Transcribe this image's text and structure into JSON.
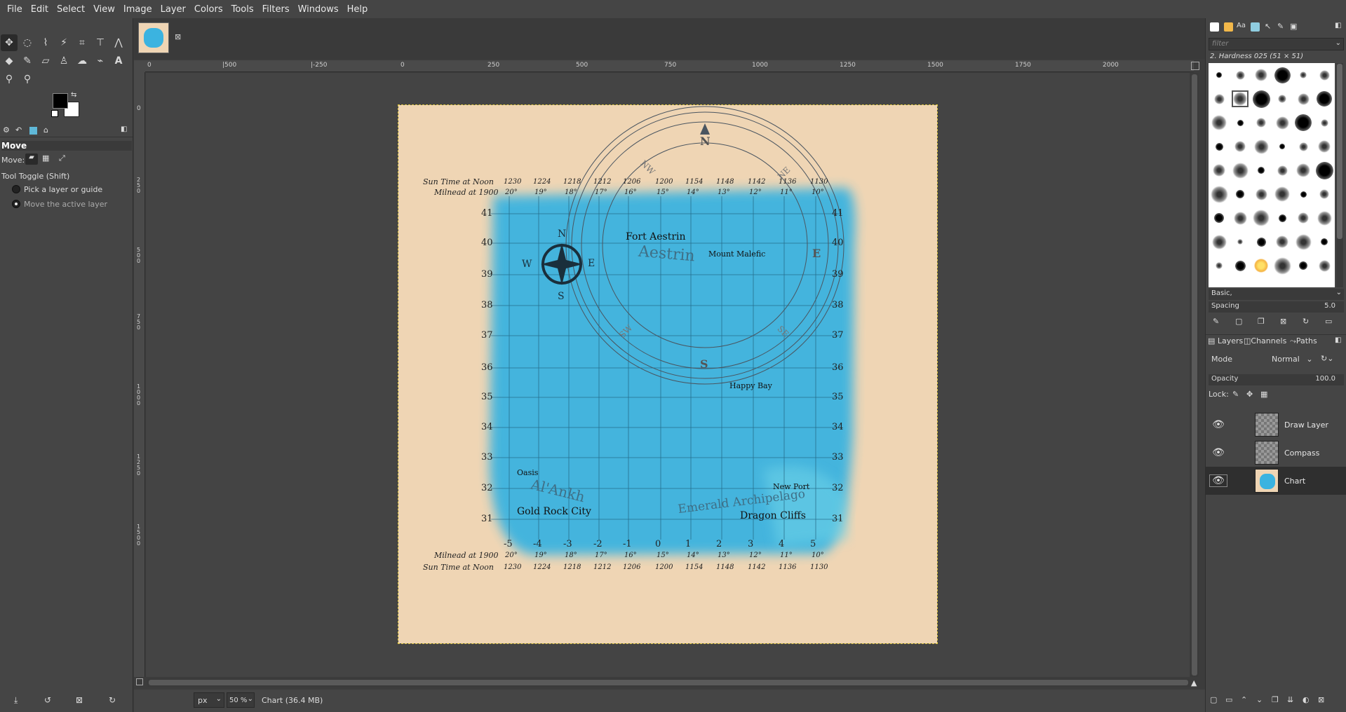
{
  "menu": [
    "File",
    "Edit",
    "Select",
    "View",
    "Image",
    "Layer",
    "Colors",
    "Tools",
    "Filters",
    "Windows",
    "Help"
  ],
  "tool_options": {
    "title": "Move",
    "move_label": "Move:",
    "toggle_label": "Tool Toggle  (Shift)",
    "option1": "Pick a layer or guide",
    "option2": "Move the active layer"
  },
  "hruler_ticks": [
    "0",
    "|500",
    "|-250",
    "0",
    "250",
    "500",
    "750",
    "1000",
    "1250",
    "1500",
    "1750",
    "2000"
  ],
  "vruler_ticks": [
    "0",
    "2\n5\n0",
    "5\n0\n0",
    "7\n5\n0",
    "1\n0\n0\n0",
    "1\n2\n5\n0",
    "1\n5\n0\n0"
  ],
  "map": {
    "top_row_label1": "Sun Time at Noon",
    "top_row_label2": "Milnead at 1900",
    "bottom_row_label1": "Milnead at 1900",
    "bottom_row_label2": "Sun Time at Noon",
    "sun_times": [
      "1230",
      "1224",
      "1218",
      "1212",
      "1206",
      "1200",
      "1154",
      "1148",
      "1142",
      "1136",
      "1130"
    ],
    "milnead": [
      "20°",
      "19°",
      "18°",
      "17°",
      "16°",
      "15°",
      "14°",
      "13°",
      "12°",
      "11°",
      "10°"
    ],
    "lat_labels": [
      "41",
      "40",
      "39",
      "38",
      "37",
      "36",
      "35",
      "34",
      "33",
      "32",
      "31"
    ],
    "lon_labels": [
      "-5",
      "-4",
      "-3",
      "-2",
      "-1",
      "0",
      "1",
      "2",
      "3",
      "4",
      "5"
    ],
    "places": {
      "fort": "Fort Aestrin",
      "region_aestrin": "Aestrin",
      "mount": "Mount Malefic",
      "happy": "Happy Bay",
      "oasis": "Oasis",
      "alankh": "Al'Ankh",
      "goldrock": "Gold Rock City",
      "newport": "New Port",
      "emerald": "Emerald Archipelago",
      "dragon": "Dragon Cliffs"
    },
    "compass_small": {
      "n": "N",
      "s": "S",
      "e": "E",
      "w": "W"
    },
    "compass_big": {
      "n": "N",
      "s": "S",
      "e": "E",
      "nw": "NW",
      "ne": "NE",
      "sw": "SW",
      "se": "SE"
    }
  },
  "dock": {
    "filter_placeholder": "filter",
    "brush_name": "2. Hardness 025 (51 × 51)",
    "brush_set": "Basic,",
    "spacing_label": "Spacing",
    "spacing_value": "5.0",
    "tabs": [
      "Layers",
      "Channels",
      "Paths"
    ],
    "mode_label": "Mode",
    "mode_value": "Normal",
    "opacity_label": "Opacity",
    "opacity_value": "100.0",
    "lock_label": "Lock:",
    "layers": [
      {
        "name": "Draw Layer"
      },
      {
        "name": "Compass"
      },
      {
        "name": "Chart"
      }
    ]
  },
  "status": {
    "unit": "px",
    "zoom": "50 %",
    "info": "Chart (36.4 MB)"
  },
  "colors": {
    "sea": "#3bb3e0",
    "paper": "#efd5b4"
  }
}
